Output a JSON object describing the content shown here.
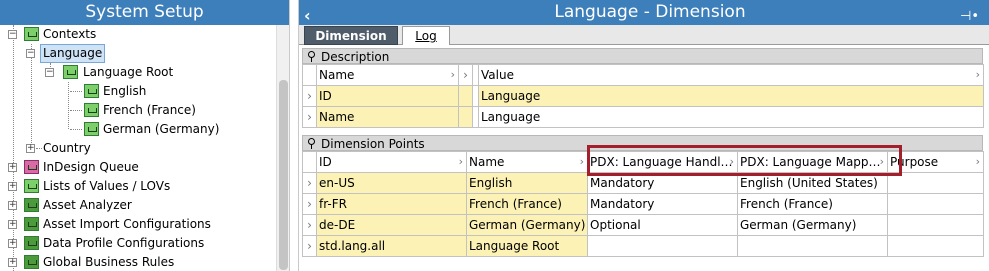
{
  "left_panel": {
    "title": "System Setup",
    "tree": [
      {
        "label": "Contexts",
        "expander": "−",
        "icon": "hierarchy-icon"
      },
      {
        "label": "Language",
        "expander": "−",
        "selected": true
      },
      {
        "label": "Language Root",
        "expander": "−",
        "icon": "hierarchy-icon"
      },
      {
        "label": "English",
        "icon": "hierarchy-icon"
      },
      {
        "label": "French (France)",
        "icon": "hierarchy-icon"
      },
      {
        "label": "German (Germany)",
        "icon": "hierarchy-icon"
      },
      {
        "label": "Country",
        "expander": "+"
      },
      {
        "label": "InDesign Queue",
        "expander": "+",
        "icon": "queue-icon"
      },
      {
        "label": "Lists of Values / LOVs",
        "expander": "+",
        "icon": "list-icon"
      },
      {
        "label": "Asset Analyzer",
        "expander": "+",
        "icon": "folder-icon"
      },
      {
        "label": "Asset Import Configurations",
        "expander": "+",
        "icon": "folder-icon"
      },
      {
        "label": "Data Profile Configurations",
        "expander": "+",
        "icon": "folder-icon"
      },
      {
        "label": "Global Business Rules",
        "expander": "+",
        "icon": "folder-icon"
      }
    ]
  },
  "right_panel": {
    "title": "Language - Dimension",
    "back_icon": "‹",
    "pin_icon": "⊣•",
    "tabs": [
      {
        "label": "Dimension",
        "active": true
      },
      {
        "label": "Log",
        "active": false
      }
    ],
    "description": {
      "title": "Description",
      "columns": [
        "Name",
        "Value"
      ],
      "rows": [
        {
          "name": "ID",
          "value": "Language"
        },
        {
          "name": "Name",
          "value": "Language"
        }
      ]
    },
    "dimension_points": {
      "title": "Dimension Points",
      "columns": [
        "ID",
        "Name",
        "PDX: Language Handl…",
        "PDX: Language Mapp…",
        "Purpose"
      ],
      "rows": [
        {
          "id": "en-US",
          "name": "English",
          "handling": "Mandatory",
          "mapping": "English (United States)",
          "purpose": ""
        },
        {
          "id": "fr-FR",
          "name": "French (France)",
          "handling": "Mandatory",
          "mapping": "French (France)",
          "purpose": ""
        },
        {
          "id": "de-DE",
          "name": "German (Germany)",
          "handling": "Optional",
          "mapping": "German (Germany)",
          "purpose": ""
        },
        {
          "id": "std.lang.all",
          "name": "Language Root",
          "handling": "",
          "mapping": "",
          "purpose": ""
        }
      ]
    }
  },
  "colors": {
    "title_bar": "#3d7fba",
    "highlight_box": "#a31f2c",
    "editable_cell": "#fcf2b6",
    "active_tab": "#4f5c69"
  }
}
